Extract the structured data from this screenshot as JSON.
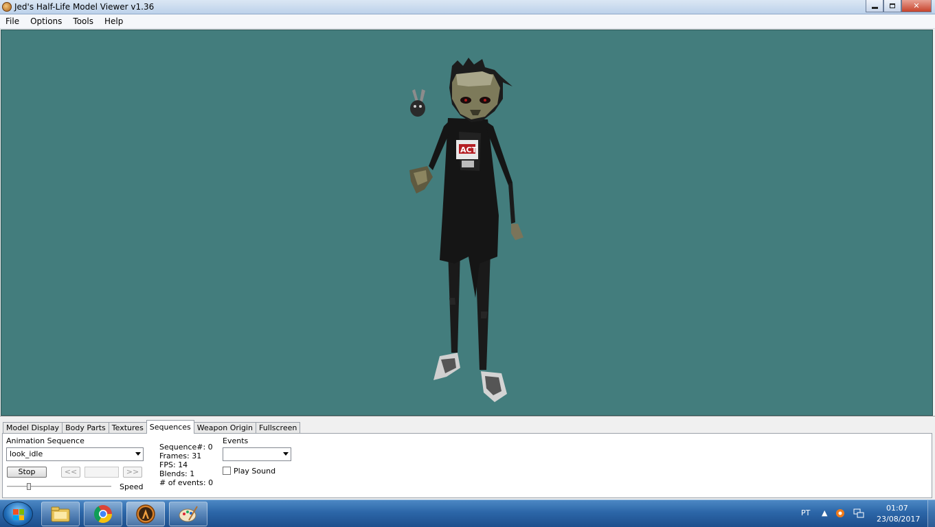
{
  "window": {
    "title": "Jed's Half-Life Model Viewer v1.36",
    "minimize_icon": "minimize-icon",
    "maximize_icon": "restore-icon",
    "close_glyph": "✕"
  },
  "menu": [
    "File",
    "Options",
    "Tools",
    "Help"
  ],
  "viewport": {
    "background": "#437d7d"
  },
  "tabs": [
    "Model Display",
    "Body Parts",
    "Textures",
    "Sequences",
    "Weapon Origin",
    "Fullscreen"
  ],
  "active_tab": "Sequences",
  "sequences": {
    "animation_label": "Animation Sequence",
    "animation_value": "look_idle",
    "stop_label": "Stop",
    "prev_label": "<<",
    "next_label": ">>",
    "speed_label": "Speed",
    "speed_fraction": 0.2,
    "info": {
      "sequence": "Sequence#: 0",
      "frames": "Frames: 31",
      "fps": "FPS: 14",
      "blends": "Blends: 1",
      "events": "# of events: 0"
    },
    "events_label": "Events",
    "events_value": "",
    "play_sound_label": "Play Sound",
    "play_sound_checked": false
  },
  "taskbar": {
    "apps": [
      "explorer-icon",
      "chrome-icon",
      "half-life-icon",
      "paint-icon"
    ],
    "language": "PT",
    "time": "01:07",
    "date": "23/08/2017"
  }
}
